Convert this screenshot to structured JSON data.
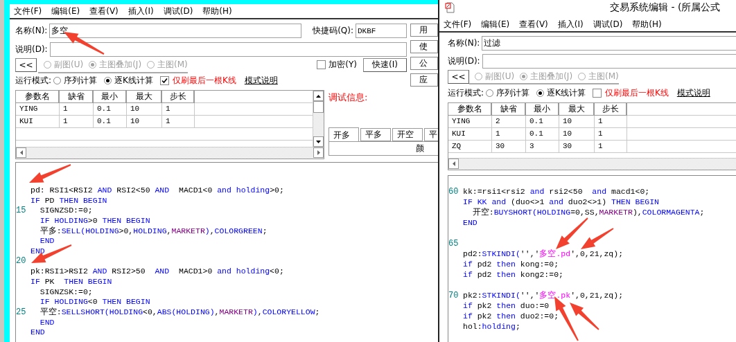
{
  "left_window": {
    "menu": [
      "文件(F)",
      "编辑(E)",
      "查看(V)",
      "插入(I)",
      "调试(D)",
      "帮助(H)"
    ],
    "name_label": "名称(N):",
    "name_value": "多空",
    "shortcut_label": "快捷码(Q):",
    "shortcut_value": "DKBF",
    "desc_label": "说明(D):",
    "collapse_button": "<<",
    "chart_options": [
      {
        "label": "副图(U)",
        "selected": false,
        "disabled": true
      },
      {
        "label": "主图叠加(J)",
        "selected": true,
        "disabled": true
      },
      {
        "label": "主图(M)",
        "selected": false,
        "disabled": true
      }
    ],
    "encrypt": {
      "label": "加密(Y)",
      "checked": false
    },
    "quick_button": "快速(I)",
    "side_buttons": [
      "用",
      "使",
      "公",
      "应"
    ],
    "run_mode_label": "运行模式:",
    "run_modes": [
      {
        "label": "序列计算",
        "selected": false
      },
      {
        "label": "逐K线计算",
        "selected": true
      }
    ],
    "last_bar_only": {
      "label": "仅刷最后一根K线",
      "checked": true
    },
    "mode_help": "模式说明",
    "params": {
      "columns": [
        "参数名",
        "缺省",
        "最小",
        "最大",
        "步长"
      ],
      "rows": [
        [
          "YING",
          "1",
          "0.1",
          "10",
          "1"
        ],
        [
          "KUI",
          "1",
          "0.1",
          "10",
          "1"
        ]
      ]
    },
    "debug_label": "调试信息:",
    "signal_tabs": [
      {
        "label": "开多",
        "selected": true
      },
      {
        "label": "平多",
        "selected": false
      },
      {
        "label": "开空",
        "selected": false
      },
      {
        "label": "平",
        "selected": false
      }
    ],
    "tab_content": "颜",
    "code_lines": [
      {
        "kind": "code",
        "tokens": [
          {
            "kind": "plain",
            "text": "pd: RSI1<RSI2 "
          },
          {
            "kind": "keyword",
            "text": "AND"
          },
          {
            "kind": "plain",
            "text": " RSI2<50 "
          },
          {
            "kind": "keyword",
            "text": "AND"
          },
          {
            "kind": "plain",
            "text": "  MACD1<0 "
          },
          {
            "kind": "keyword",
            "text": "and holding"
          },
          {
            "kind": "plain",
            "text": ">0;"
          }
        ]
      },
      {
        "kind": "code",
        "tokens": [
          {
            "kind": "keyword",
            "text": "IF"
          },
          {
            "kind": "plain",
            "text": " PD "
          },
          {
            "kind": "keyword",
            "text": "THEN BEGIN"
          }
        ]
      },
      {
        "kind": "code",
        "number": "15",
        "tokens": [
          {
            "kind": "plain",
            "text": "  SIGNZSD:=0;"
          }
        ]
      },
      {
        "kind": "code",
        "tokens": [
          {
            "kind": "keyword",
            "text": "  IF HOLDING"
          },
          {
            "kind": "plain",
            "text": ">0 "
          },
          {
            "kind": "keyword",
            "text": "THEN BEGIN"
          }
        ]
      },
      {
        "kind": "code",
        "tokens": [
          {
            "kind": "plain",
            "text": "  平多:"
          },
          {
            "kind": "keyword",
            "text": "SELL(HOLDING"
          },
          {
            "kind": "plain",
            "text": ">0,"
          },
          {
            "kind": "keyword",
            "text": "HOLDING"
          },
          {
            "kind": "plain",
            "text": ","
          },
          {
            "kind": "constant",
            "text": "MARKETR"
          },
          {
            "kind": "keyword",
            "text": ")"
          },
          {
            "kind": "plain",
            "text": ","
          },
          {
            "kind": "keyword",
            "text": "COLORGREEN"
          },
          {
            "kind": "plain",
            "text": ";"
          }
        ]
      },
      {
        "kind": "code",
        "tokens": [
          {
            "kind": "keyword",
            "text": "  END"
          }
        ]
      },
      {
        "kind": "code",
        "tokens": [
          {
            "kind": "keyword",
            "text": "END"
          }
        ]
      },
      {
        "kind": "blank",
        "number": "20"
      },
      {
        "kind": "code",
        "tokens": [
          {
            "kind": "plain",
            "text": "pk:RSI1>RSI2 "
          },
          {
            "kind": "keyword",
            "text": "AND"
          },
          {
            "kind": "plain",
            "text": " RSI2>50  "
          },
          {
            "kind": "keyword",
            "text": "AND"
          },
          {
            "kind": "plain",
            "text": "  MACD1>0 "
          },
          {
            "kind": "keyword",
            "text": "and holding"
          },
          {
            "kind": "plain",
            "text": "<0;"
          }
        ]
      },
      {
        "kind": "code",
        "tokens": [
          {
            "kind": "keyword",
            "text": "IF"
          },
          {
            "kind": "plain",
            "text": " PK  "
          },
          {
            "kind": "keyword",
            "text": "THEN BEGIN"
          }
        ]
      },
      {
        "kind": "code",
        "tokens": [
          {
            "kind": "plain",
            "text": "  SIGNZSK:=0;"
          }
        ]
      },
      {
        "kind": "code",
        "tokens": [
          {
            "kind": "keyword",
            "text": "  IF HOLDING"
          },
          {
            "kind": "plain",
            "text": "<0 "
          },
          {
            "kind": "keyword",
            "text": "THEN BEGIN"
          }
        ]
      },
      {
        "kind": "code",
        "number": "25",
        "tokens": [
          {
            "kind": "plain",
            "text": "  平空:"
          },
          {
            "kind": "keyword",
            "text": "SELLSHORT(HOLDING"
          },
          {
            "kind": "plain",
            "text": "<0,"
          },
          {
            "kind": "keyword",
            "text": "ABS(HOLDING)"
          },
          {
            "kind": "plain",
            "text": ","
          },
          {
            "kind": "constant",
            "text": "MARKETR"
          },
          {
            "kind": "keyword",
            "text": ")"
          },
          {
            "kind": "plain",
            "text": ","
          },
          {
            "kind": "keyword",
            "text": "COLORYELLOW"
          },
          {
            "kind": "plain",
            "text": ";"
          }
        ]
      },
      {
        "kind": "code",
        "tokens": [
          {
            "kind": "keyword",
            "text": "  END"
          }
        ]
      },
      {
        "kind": "code",
        "tokens": [
          {
            "kind": "keyword",
            "text": "END"
          }
        ]
      }
    ]
  },
  "right_window": {
    "title": "交易系统编辑 - (所属公式",
    "menu": [
      "文件(F)",
      "编辑(E)",
      "查看(V)",
      "插入(I)",
      "调试(D)",
      "帮助(H)"
    ],
    "name_label": "名称(N):",
    "name_value": "过滤",
    "desc_label": "说明(D):",
    "collapse_button": "<<",
    "chart_options": [
      {
        "label": "副图(U)",
        "selected": false,
        "disabled": true
      },
      {
        "label": "主图叠加(J)",
        "selected": true,
        "disabled": true
      },
      {
        "label": "主图(M)",
        "selected": false,
        "disabled": true
      }
    ],
    "run_mode_label": "运行模式:",
    "run_modes": [
      {
        "label": "序列计算",
        "selected": false
      },
      {
        "label": "逐K线计算",
        "selected": true
      }
    ],
    "last_bar_only": {
      "label": "仅刷最后一根K线",
      "checked": false
    },
    "mode_help": "模式说明",
    "params": {
      "columns": [
        "参数名",
        "缺省",
        "最小",
        "最大",
        "步长"
      ],
      "rows": [
        [
          "YING",
          "2",
          "0.1",
          "10",
          "1"
        ],
        [
          "KUI",
          "1",
          "0.1",
          "10",
          "1"
        ],
        [
          "ZQ",
          "30",
          "3",
          "30",
          "1"
        ]
      ]
    },
    "code_lines": [
      {
        "kind": "code",
        "number": "60",
        "tokens": [
          {
            "kind": "plain",
            "text": "kk:=rsi1<rsi2 "
          },
          {
            "kind": "keyword",
            "text": "and"
          },
          {
            "kind": "plain",
            "text": " rsi2<50  "
          },
          {
            "kind": "keyword",
            "text": "and"
          },
          {
            "kind": "plain",
            "text": " macd1<0;"
          }
        ]
      },
      {
        "kind": "code",
        "tokens": [
          {
            "kind": "keyword",
            "text": "IF KK and"
          },
          {
            "kind": "plain",
            "text": " (duo<>1 "
          },
          {
            "kind": "keyword",
            "text": "and"
          },
          {
            "kind": "plain",
            "text": " duo2<>1) "
          },
          {
            "kind": "keyword",
            "text": "THEN BEGIN"
          }
        ]
      },
      {
        "kind": "code",
        "tokens": [
          {
            "kind": "plain",
            "text": "  开空:"
          },
          {
            "kind": "keyword",
            "text": "BUYSHORT(HOLDING"
          },
          {
            "kind": "plain",
            "text": "=0,SS,"
          },
          {
            "kind": "constant",
            "text": "MARKETR"
          },
          {
            "kind": "plain",
            "text": "),"
          },
          {
            "kind": "keyword",
            "text": "COLORMAGENTA"
          },
          {
            "kind": "plain",
            "text": ";"
          }
        ]
      },
      {
        "kind": "code",
        "tokens": [
          {
            "kind": "keyword",
            "text": "END"
          }
        ]
      },
      {
        "kind": "blank"
      },
      {
        "kind": "blank",
        "number": "65"
      },
      {
        "kind": "code",
        "tokens": [
          {
            "kind": "plain",
            "text": "pd2:"
          },
          {
            "kind": "keyword",
            "text": "STKINDI("
          },
          {
            "kind": "plain",
            "text": "'','"
          },
          {
            "kind": "string",
            "text": "多空.pd"
          },
          {
            "kind": "plain",
            "text": "',0,21,zq);"
          }
        ]
      },
      {
        "kind": "code",
        "tokens": [
          {
            "kind": "keyword",
            "text": "if"
          },
          {
            "kind": "plain",
            "text": " pd2 "
          },
          {
            "kind": "keyword",
            "text": "then"
          },
          {
            "kind": "plain",
            "text": " kong:=0;"
          }
        ]
      },
      {
        "kind": "code",
        "tokens": [
          {
            "kind": "keyword",
            "text": "if"
          },
          {
            "kind": "plain",
            "text": " pd2 "
          },
          {
            "kind": "keyword",
            "text": "then"
          },
          {
            "kind": "plain",
            "text": " kong2:=0;"
          }
        ]
      },
      {
        "kind": "blank"
      },
      {
        "kind": "code",
        "number": "70",
        "tokens": [
          {
            "kind": "plain",
            "text": "pk2:"
          },
          {
            "kind": "keyword",
            "text": "STKINDI("
          },
          {
            "kind": "plain",
            "text": "'','"
          },
          {
            "kind": "string",
            "text": "多空.pk"
          },
          {
            "kind": "plain",
            "text": "',0,21,zq);"
          }
        ]
      },
      {
        "kind": "code",
        "tokens": [
          {
            "kind": "keyword",
            "text": "if"
          },
          {
            "kind": "plain",
            "text": " pk2 "
          },
          {
            "kind": "keyword",
            "text": "then"
          },
          {
            "kind": "plain",
            "text": " duo:=0"
          }
        ]
      },
      {
        "kind": "code",
        "tokens": [
          {
            "kind": "keyword",
            "text": "if"
          },
          {
            "kind": "plain",
            "text": " pk2 "
          },
          {
            "kind": "keyword",
            "text": "then"
          },
          {
            "kind": "plain",
            "text": " duo2:=0;"
          }
        ]
      },
      {
        "kind": "code",
        "tokens": [
          {
            "kind": "plain",
            "text": "hol:"
          },
          {
            "kind": "keyword",
            "text": "holding"
          },
          {
            "kind": "plain",
            "text": ";"
          }
        ]
      }
    ]
  }
}
